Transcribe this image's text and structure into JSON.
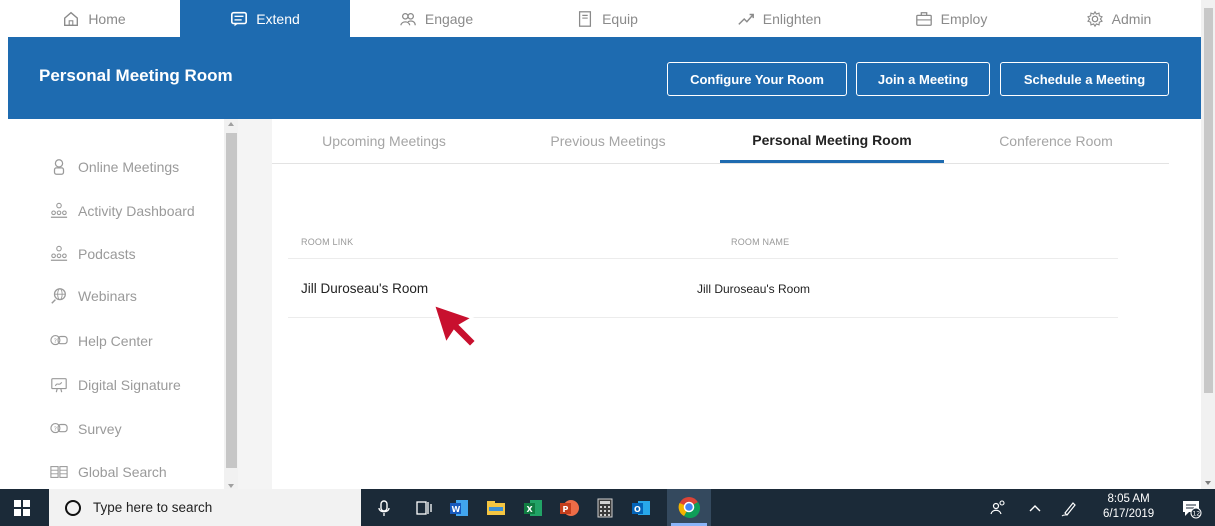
{
  "topnav": {
    "tabs": [
      {
        "label": "Home",
        "icon": "home-icon"
      },
      {
        "label": "Extend",
        "icon": "chat-icon"
      },
      {
        "label": "Engage",
        "icon": "people-icon"
      },
      {
        "label": "Equip",
        "icon": "document-icon"
      },
      {
        "label": "Enlighten",
        "icon": "trend-icon"
      },
      {
        "label": "Employ",
        "icon": "briefcase-icon"
      },
      {
        "label": "Admin",
        "icon": "gear-icon"
      }
    ],
    "active": "Extend",
    "accent": "#1e6bb0"
  },
  "header": {
    "title": "Personal Meeting Room",
    "buttons": [
      "Configure Your Room",
      "Join a Meeting",
      "Schedule a Meeting"
    ]
  },
  "sidebar": {
    "items": [
      {
        "label": "Online Meetings",
        "icon": "person-icon"
      },
      {
        "label": "Activity Dashboard",
        "icon": "group-icon"
      },
      {
        "label": "Podcasts",
        "icon": "group-icon"
      },
      {
        "label": "Webinars",
        "icon": "globe-icon"
      },
      {
        "label": "Help Center",
        "icon": "chat-bubbles-icon"
      },
      {
        "label": "Digital Signature",
        "icon": "signature-icon"
      },
      {
        "label": "Survey",
        "icon": "chat-bubbles-icon"
      },
      {
        "label": "Global Search",
        "icon": "grid-search-icon"
      }
    ]
  },
  "main": {
    "tabs": [
      "Upcoming Meetings",
      "Previous Meetings",
      "Personal Meeting Room",
      "Conference Room"
    ],
    "active_tab": "Personal Meeting Room",
    "columns": [
      "ROOM LINK",
      "ROOM NAME"
    ],
    "rows": [
      {
        "room_link": "Jill Duroseau's Room",
        "room_name": "Jill Duroseau's Room"
      }
    ]
  },
  "taskbar": {
    "search_placeholder": "Type here to search",
    "apps": [
      "microphone-icon",
      "task-view-icon",
      "word-icon",
      "file-explorer-icon",
      "excel-icon",
      "powerpoint-icon",
      "calculator-icon",
      "outlook-icon",
      "chrome-icon"
    ],
    "time": "8:05 AM",
    "date": "6/17/2019",
    "notification_count": "12"
  }
}
